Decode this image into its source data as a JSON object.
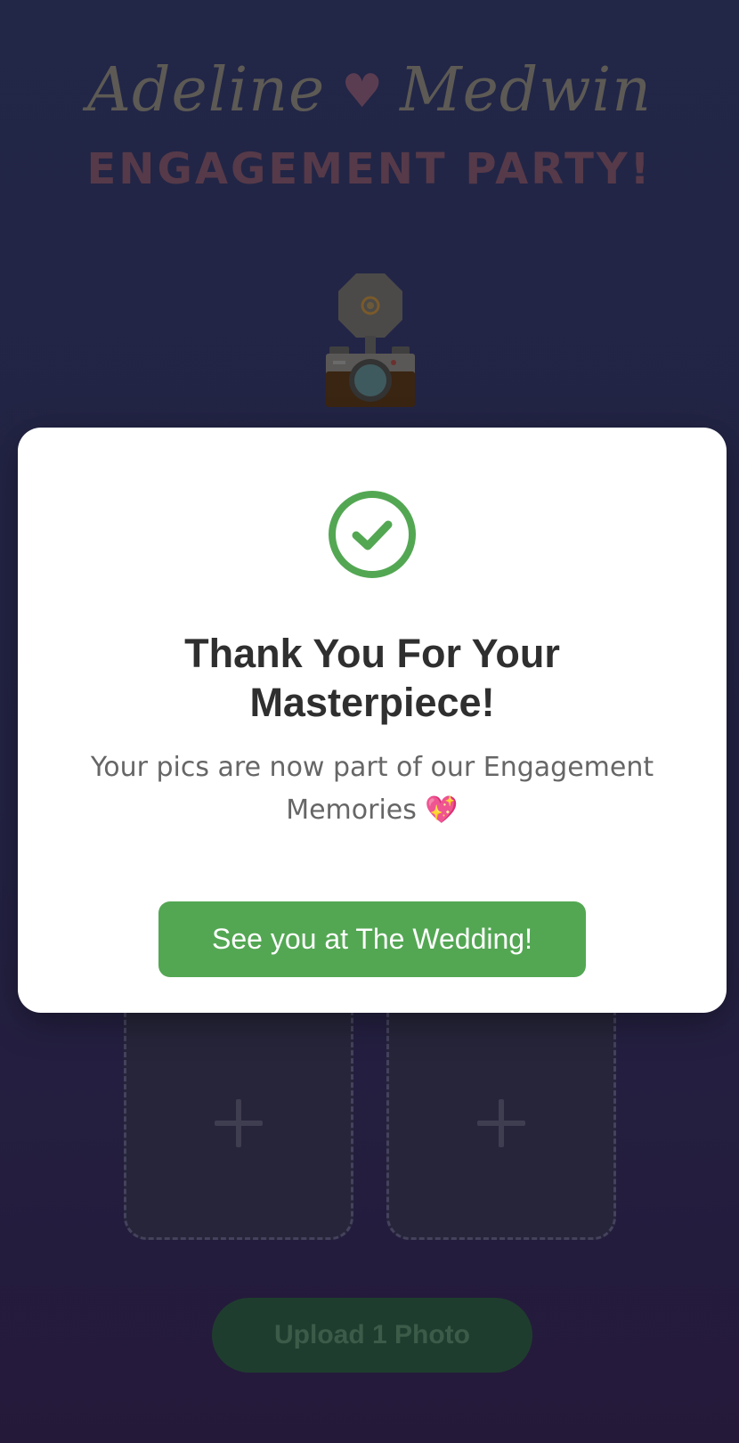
{
  "header": {
    "name_left": "Adeline",
    "heart": "♥",
    "name_right": "Medwin",
    "subtitle": "ENGAGEMENT PARTY!"
  },
  "upload": {
    "button_label": "Upload 1 Photo",
    "slot_icon": "plus-icon"
  },
  "modal": {
    "icon": "check-circle-icon",
    "title": "Thank You For Your Masterpiece!",
    "message": "Your pics are now part of our Engagement Memories 💖",
    "button_label": "See you at The Wedding!"
  },
  "colors": {
    "success_green": "#53a753",
    "title_text": "#2f2f2f",
    "body_text": "#666666"
  }
}
